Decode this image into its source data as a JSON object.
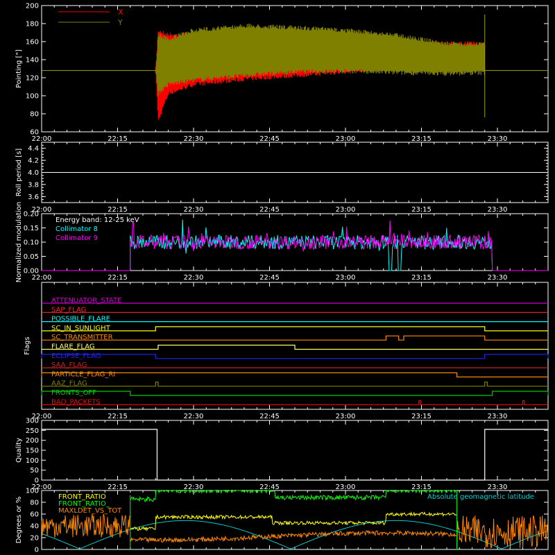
{
  "x_time_labels": [
    "22:00",
    "22:15",
    "22:30",
    "22:45",
    "23:00",
    "23:15",
    "23:30"
  ],
  "chart_data": [
    {
      "id": "pointing",
      "type": "line",
      "ylabel": "Pointing [\"]",
      "ylim": [
        60,
        200
      ],
      "yticks": [
        60,
        80,
        100,
        120,
        140,
        160,
        180,
        200
      ],
      "xlim": [
        0,
        100
      ],
      "grid": false,
      "legend_position": "top-left",
      "series": [
        {
          "name": "X",
          "color": "#ff0000",
          "envelope_x": [
            22.5,
            23,
            25,
            30,
            40,
            50,
            60,
            70,
            80,
            87.5
          ],
          "upper": [
            128,
            175,
            170,
            170,
            168,
            166,
            164,
            162,
            160,
            160
          ],
          "lower": [
            128,
            70,
            100,
            110,
            116,
            120,
            124,
            128,
            140,
            145
          ]
        },
        {
          "name": "Y",
          "color": "#808000",
          "envelope_x": [
            22.5,
            23,
            25,
            30,
            40,
            50,
            60,
            70,
            80,
            87.5
          ],
          "upper": [
            128,
            170,
            165,
            175,
            180,
            178,
            175,
            170,
            160,
            160
          ],
          "lower": [
            128,
            100,
            110,
            115,
            120,
            124,
            125,
            123,
            122,
            123
          ]
        }
      ],
      "baseline": 128
    },
    {
      "id": "roll",
      "type": "line",
      "ylabel": "Roll period [s]",
      "ylim": [
        3.5,
        4.5
      ],
      "yticks": [
        3.6,
        3.8,
        4.0,
        4.2,
        4.4
      ],
      "series": [
        {
          "color": "#ffffff",
          "x": [
            0,
            100
          ],
          "values": [
            4.0,
            4.0
          ]
        }
      ]
    },
    {
      "id": "modulation",
      "type": "line",
      "ylabel": "Normalized modulation",
      "ylim": [
        0,
        0.2
      ],
      "yticks": [
        0.0,
        0.05,
        0.1,
        0.15,
        0.2
      ],
      "annotation": "Energy band: 12-25 keV",
      "series": [
        {
          "name": "Collimator 8",
          "color": "#00ffff",
          "start": 17.5,
          "end": 89,
          "mean": 0.1
        },
        {
          "name": "Collimator 9",
          "color": "#ff00ff",
          "start": 17.5,
          "end": 89,
          "mean": 0.1
        }
      ]
    },
    {
      "id": "flags",
      "type": "line",
      "ylabel": "Flags",
      "series": [
        {
          "name": "ATTENUATOR_STATE",
          "color": "#cc00cc",
          "steps": []
        },
        {
          "name": "SAP_FLAG",
          "color": "#ff2222",
          "steps": []
        },
        {
          "name": "POSSIBLE_FLARE",
          "color": "#00ffff",
          "steps": []
        },
        {
          "name": "SC_IN_SUNLIGHT",
          "color": "#ffff00",
          "steps": [
            [
              22.5,
              87.5
            ]
          ]
        },
        {
          "name": "SC_TRANSMITTER",
          "color": "#ff8800",
          "steps": [
            [
              68,
              70.5
            ],
            [
              71.5,
              87.5
            ]
          ]
        },
        {
          "name": "FLARE_FLAG",
          "color": "#ffff66",
          "steps": [
            [
              23,
              50
            ]
          ]
        },
        {
          "name": "ECLIPSE_FLAG",
          "color": "#2222ff",
          "steps": [
            [
              0,
              22.5
            ],
            [
              87.5,
              100
            ]
          ]
        },
        {
          "name": "SAA_FLAG",
          "color": "#cc2222",
          "steps": []
        },
        {
          "name": "PARTICLE_FLAG_RI",
          "color": "#ff8800",
          "steps": [
            [
              0,
              82
            ]
          ]
        },
        {
          "name": "AAZ_FLAG",
          "color": "#808000",
          "steps": [
            [
              22.5,
              23
            ],
            [
              87.5,
              88
            ]
          ]
        },
        {
          "name": "FRONTS_OFF",
          "color": "#00cc00",
          "steps": [
            [
              0,
              17.5
            ],
            [
              89,
              100
            ]
          ]
        },
        {
          "name": "BAD_PACKETS",
          "color": "#ff0000",
          "steps": [
            [
              74.5,
              74.8
            ],
            [
              95,
              95.3
            ]
          ]
        }
      ]
    },
    {
      "id": "quality",
      "type": "line",
      "ylabel": "Quality",
      "ylim": [
        0,
        300
      ],
      "yticks": [
        0,
        50,
        100,
        150,
        200,
        250,
        300
      ],
      "series": [
        {
          "color": "#ffffff",
          "x": [
            0,
            22.8,
            22.8,
            87.5,
            87.5,
            100
          ],
          "values": [
            255,
            255,
            0,
            0,
            255,
            255
          ]
        }
      ]
    },
    {
      "id": "ratios",
      "type": "line",
      "ylabel": "Degrees or %",
      "ylim": [
        0,
        100
      ],
      "yticks": [
        0,
        20,
        40,
        60,
        80,
        100
      ],
      "series": [
        {
          "name": "FRONT_RATIO",
          "color": "#ffff00"
        },
        {
          "name": "FRONT_RATIO_",
          "color": "#00ff00"
        },
        {
          "name": "MAXLDET_VS_TOT",
          "color": "#ff8800"
        },
        {
          "name": "Absolute geomagnetic latitude",
          "color": "#00cccc"
        }
      ]
    }
  ]
}
